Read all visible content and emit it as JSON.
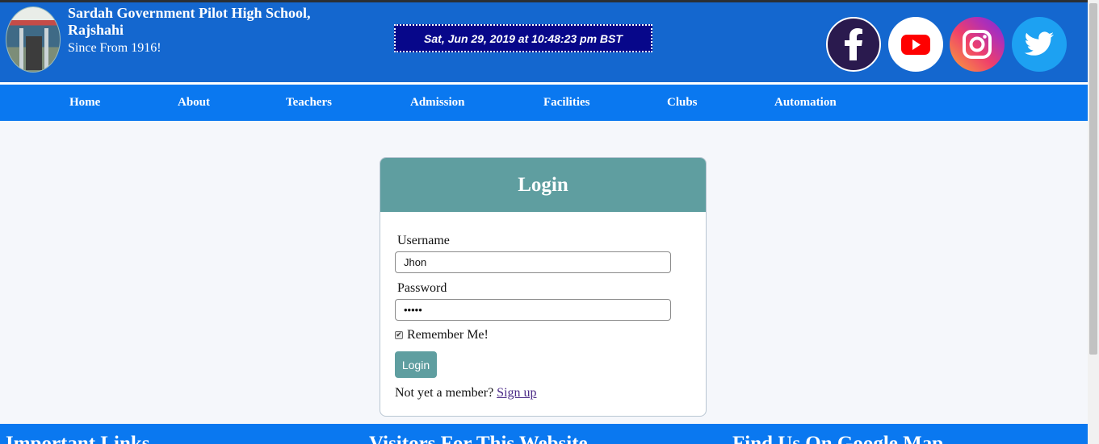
{
  "header": {
    "school_name": "Sardah Government Pilot High School, Rajshahi",
    "since": "Since From 1916!",
    "clock": "Sat, Jun 29, 2019 at 10:48:23 pm BST"
  },
  "social": [
    {
      "name": "facebook-icon",
      "color": "#2a1a4e"
    },
    {
      "name": "youtube-icon",
      "color": "#ff0000"
    },
    {
      "name": "instagram-icon",
      "color": "#e1306c"
    },
    {
      "name": "twitter-icon",
      "color": "#1da1f2"
    }
  ],
  "nav": {
    "items": [
      "Home",
      "About",
      "Teachers",
      "Admission",
      "Facilities",
      "Clubs",
      "Automation"
    ]
  },
  "login": {
    "title": "Login",
    "username_label": "Username",
    "username_value": "Jhon",
    "password_label": "Password",
    "password_value": "•••••",
    "remember_label": "Remember Me!",
    "remember_checked": true,
    "button_label": "Login",
    "member_text": "Not yet a member?",
    "signup_link": "Sign up"
  },
  "footer": {
    "headings": [
      "Important Links",
      "Visitors For This Website",
      "Find Us On Google Map"
    ]
  },
  "colors": {
    "header_blue": "#1467cf",
    "nav_blue": "#0a78f0",
    "card_head": "#5f9ea0",
    "clock_bg": "#07078a"
  }
}
